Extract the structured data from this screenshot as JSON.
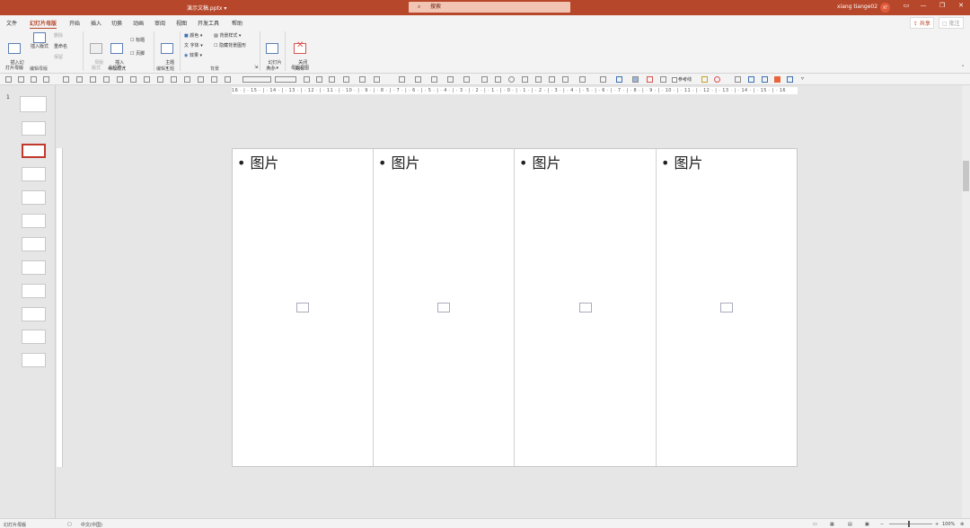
{
  "titlebar": {
    "filename": "演示文稿.pptx ▾",
    "search_placeholder": "搜索",
    "user": "xiang tiange02",
    "avatar_initials": "XT",
    "minimize": "—",
    "restore": "❐",
    "close": "✕",
    "ribbon_display": "▭"
  },
  "tabs": [
    "文件",
    "幻灯片母版",
    "开始",
    "插入",
    "切换",
    "动画",
    "审阅",
    "视图",
    "开发工具",
    "帮助"
  ],
  "active_tab": "幻灯片母版",
  "share_label": "⇪ 共享",
  "comment_label": "▢ 批注",
  "ribbon": {
    "insert_master": "插入幻\n灯片母版",
    "insert_layout": "插入版式",
    "delete": "删除",
    "rename": "重命名",
    "preserve": "保留",
    "group_edit_master": "编辑母版",
    "master_layout": "母版\n版式",
    "insert_placeholder": "插入\n占位符 ▾",
    "title_chk": "标题",
    "footer_chk": "页脚",
    "group_master_layout": "母版版式",
    "themes": "主题\n▾",
    "group_edit_theme": "编辑主题",
    "colors": "颜色 ▾",
    "fonts": "字体 ▾",
    "effects": "效果 ▾",
    "bg_styles": "背景样式 ▾",
    "hide_bg": "隐藏背景图形",
    "group_background": "背景",
    "slide_size": "幻灯片\n大小 ▾",
    "group_size": "大小",
    "close_master": "关闭\n母版视图",
    "group_close": "关闭"
  },
  "toolbar2": {
    "gridlines_label": "参考线"
  },
  "thumbnail_number": "1",
  "ruler_text": "16 · | · 15 · | · 14 · | · 13 · | · 12 · | · 11 · | · 10 · | · 9 · | · 8 · | · 7 · | · 6 · | · 5 · | · 4 · | · 3 · | · 2 · | · 1 · | · 0 · | · 1 · | · 2 · | · 3 · | · 4 · | · 5 · | · 6 · | · 7 · | · 8 · | · 9 · | · 10 · | · 11 · | · 12 · | · 13 · | · 14 · | · 15 · | · 16",
  "placeholders": [
    "• 图片",
    "• 图片",
    "• 图片",
    "• 图片"
  ],
  "status": {
    "view_name": "幻灯片母版",
    "language": "中文(中国)",
    "zoom": "100%"
  }
}
